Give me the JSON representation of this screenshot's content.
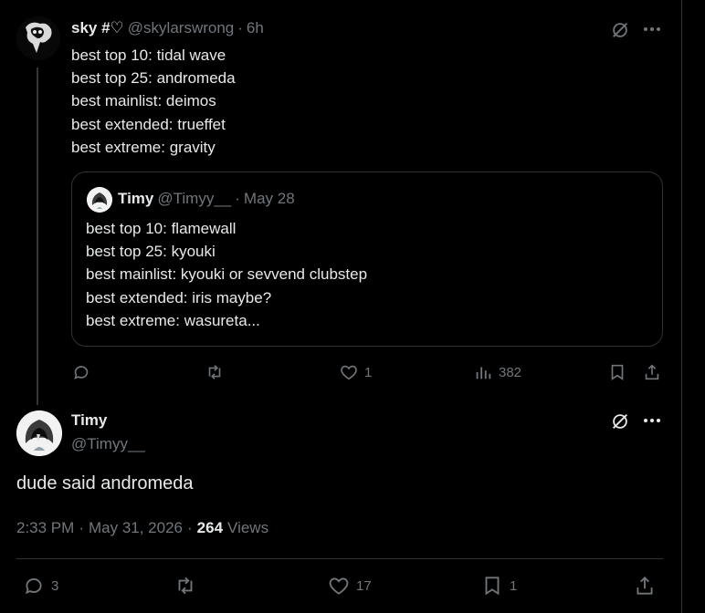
{
  "main_tweet": {
    "name": "sky #♡",
    "handle": "@skylarswrong",
    "sep": "·",
    "time": "6h",
    "lines": [
      "best top 10: tidal wave",
      "best top 25: andromeda",
      "best mainlist: deimos",
      "best extended: trueffet",
      "best extreme: gravity"
    ],
    "quote": {
      "name": "Timy",
      "handle": "@Timyy__",
      "sep": "·",
      "time": "May 28",
      "lines": [
        "best top 10: flamewall",
        "best top 25: kyouki",
        "best mainlist: kyouki or sevvend clubstep",
        "best extended: iris maybe?",
        "best extreme: wasureta..."
      ]
    },
    "actions": {
      "reply_count": "",
      "retweet_count": "",
      "like_count": "1",
      "views_count": "382"
    }
  },
  "reply_tweet": {
    "name": "Timy",
    "handle": "@Timyy__",
    "text": "dude said andromeda",
    "time": "2:33 PM",
    "sep": "·",
    "date": "May 31, 2026",
    "sep2": "·",
    "views_count": "264",
    "views_label": "Views",
    "actions": {
      "reply_count": "3",
      "retweet_count": "",
      "like_count": "17",
      "bookmark_count": "1"
    }
  },
  "icons": {
    "grok": "grok-icon",
    "more": "more-icon",
    "reply": "reply-icon",
    "retweet": "retweet-icon",
    "like": "heart-icon",
    "views": "views-icon",
    "bookmark": "bookmark-icon",
    "share": "share-icon"
  },
  "colors": {
    "background": "#000000",
    "text": "#e7e9ea",
    "muted": "#71767b",
    "border": "#2f3336"
  }
}
